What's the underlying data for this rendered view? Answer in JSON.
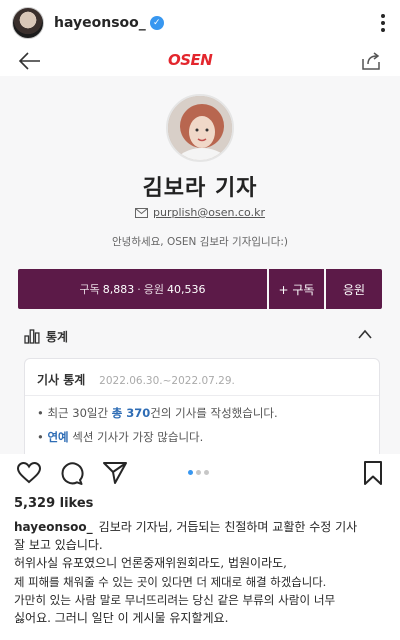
{
  "header": {
    "username": "hayeonsoo_",
    "verified_icon": "verified-badge-icon",
    "more_icon": "more-vertical-icon"
  },
  "article": {
    "logo": "OSEN",
    "reporter_name": "김보라 기자",
    "email": "purplish@osen.co.kr",
    "greeting": "안녕하세요, OSEN 김보라 기자입니다:)",
    "subscription": {
      "label_subscribers": "구독",
      "subscribers": "8,883",
      "label_support": "응원",
      "support": "40,536",
      "subscribe_button": "+ 구독",
      "cheer_button": "응원"
    },
    "stats": {
      "section_title": "통계",
      "card_title": "기사 통계",
      "period": "2022.06.30.~2022.07.29.",
      "line1_prefix": "• 최근 30일간 ",
      "line1_em": "총 370",
      "line1_suffix": "건의 기사를 작성했습니다.",
      "line2_prefix": "• ",
      "line2_em": "연예",
      "line2_suffix": " 섹션 기사가 가장 많습니다."
    }
  },
  "post": {
    "likes": "5,329 likes",
    "caption_user": "hayeonsoo_",
    "caption_lines": [
      "김보라 기자님, 거듭되는 친절하며 교활한 수정 기사",
      "잘 보고 있습니다.",
      "허위사실 유포였으니 언론중재위원회라도, 법원이라도,",
      "제 피해를 채워줄 수 있는 곳이 있다면 더 제대로 해결 하겠습니다.",
      "가만히 있는 사람 말로 무너뜨리려는 당신 같은 부류의 사람이 너무",
      "싫어요. 그러니 일단 이 게시물 유지할게요."
    ],
    "carousel": {
      "total": 3,
      "active": 1
    }
  },
  "colors": {
    "osen_red": "#e3262d",
    "subscribe_purple": "#5c1a48",
    "highlight_blue": "#2f6db5",
    "instagram_blue": "#3897f0"
  }
}
